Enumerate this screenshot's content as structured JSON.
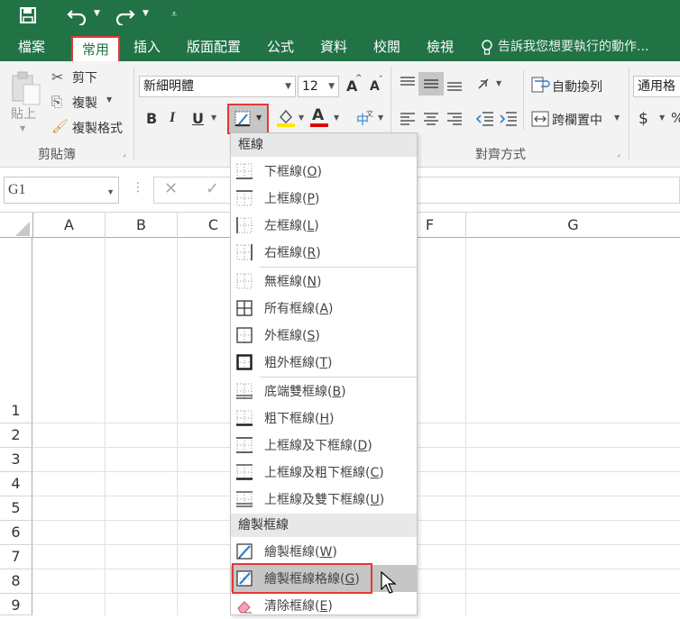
{
  "quick_access": {
    "save": "save-icon",
    "undo": "undo-icon",
    "redo": "redo-icon",
    "customize": "customize-icon"
  },
  "tabs": [
    "檔案",
    "常用",
    "插入",
    "版面配置",
    "公式",
    "資料",
    "校閱",
    "檢視"
  ],
  "active_tab": "常用",
  "tell_me": "告訴我您想要執行的動作...",
  "clipboard": {
    "paste": "貼上",
    "cut": "剪下",
    "copy": "複製",
    "format_painter": "複製格式",
    "group": "剪貼簿"
  },
  "font": {
    "name": "新細明體",
    "size": "12",
    "grow": "A",
    "shrink": "A",
    "bold": "B",
    "italic": "I",
    "underline": "U",
    "font_color_letter": "A"
  },
  "alignment": {
    "wrap_text": "自動換列",
    "merge_center": "跨欄置中",
    "group": "對齊方式"
  },
  "number": {
    "format": "通用格式",
    "currency": "$",
    "percent": "%"
  },
  "name_box": "G1",
  "columns": [
    "A",
    "B",
    "C",
    "F",
    "G"
  ],
  "rows": [
    "1",
    "2",
    "3",
    "4",
    "5",
    "6",
    "7",
    "8",
    "9"
  ],
  "border_menu": {
    "header_borders": "框線",
    "items_a": [
      {
        "label": "下框線(",
        "key": "O",
        "icon": "bottom-border-icon"
      },
      {
        "label": "上框線(",
        "key": "P",
        "icon": "top-border-icon"
      },
      {
        "label": "左框線(",
        "key": "L",
        "icon": "left-border-icon"
      },
      {
        "label": "右框線(",
        "key": "R",
        "icon": "right-border-icon"
      }
    ],
    "items_b": [
      {
        "label": "無框線(",
        "key": "N",
        "icon": "no-border-icon"
      },
      {
        "label": "所有框線(",
        "key": "A",
        "icon": "all-borders-icon"
      },
      {
        "label": "外框線(",
        "key": "S",
        "icon": "outside-borders-icon"
      },
      {
        "label": "粗外框線(",
        "key": "T",
        "icon": "thick-outside-border-icon"
      }
    ],
    "items_c": [
      {
        "label": "底端雙框線(",
        "key": "B",
        "icon": "bottom-double-border-icon"
      },
      {
        "label": "粗下框線(",
        "key": "H",
        "icon": "thick-bottom-border-icon"
      },
      {
        "label": "上框線及下框線(",
        "key": "D",
        "icon": "top-bottom-border-icon"
      },
      {
        "label": "上框線及粗下框線(",
        "key": "C",
        "icon": "top-thick-bottom-border-icon"
      },
      {
        "label": "上框線及雙下框線(",
        "key": "U",
        "icon": "top-double-bottom-border-icon"
      }
    ],
    "header_draw": "繪製框線",
    "draw_border": {
      "label": "繪製框線(",
      "key": "W"
    },
    "draw_grid": {
      "label": "繪製框線格線(",
      "key": "G"
    },
    "erase": {
      "label": "清除框線(",
      "key": "E"
    },
    "close_paren": ")"
  }
}
